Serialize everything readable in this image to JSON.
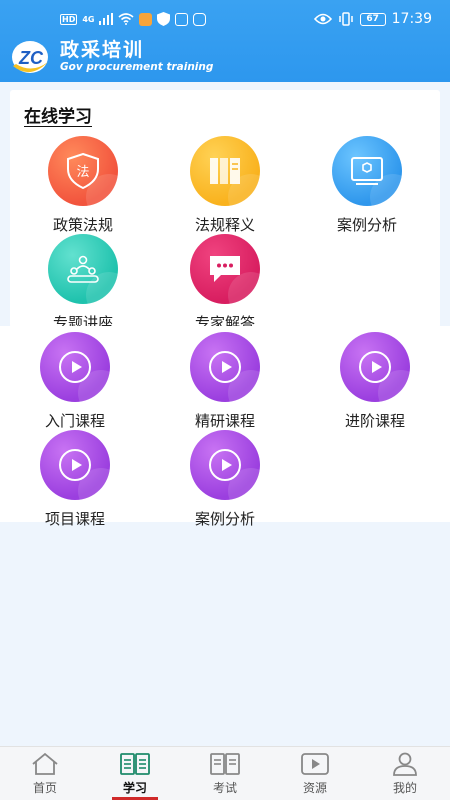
{
  "status_bar": {
    "network_type": "HD",
    "signal_type": "4G",
    "battery": "67",
    "time": "17:39"
  },
  "header": {
    "title": "政采培训",
    "subtitle": "Gov procurement training"
  },
  "online_learning": {
    "section_title": "在线学习",
    "items": [
      {
        "label": "政策法规",
        "icon": "law-shield-icon",
        "color": "#f2543d"
      },
      {
        "label": "法规释义",
        "icon": "book-shelf-icon",
        "color": "#f9b21e"
      },
      {
        "label": "案例分析",
        "icon": "case-board-icon",
        "color": "#2f97ec"
      },
      {
        "label": "专题讲座",
        "icon": "lecture-icon",
        "color": "#1fc2ad"
      },
      {
        "label": "专家解答",
        "icon": "chat-bubble-icon",
        "color": "#d81e60"
      }
    ]
  },
  "courses": {
    "items": [
      {
        "label": "入门课程",
        "icon": "play-icon"
      },
      {
        "label": "精研课程",
        "icon": "play-icon"
      },
      {
        "label": "进阶课程",
        "icon": "play-icon"
      },
      {
        "label": "项目课程",
        "icon": "play-icon"
      },
      {
        "label": "案例分析",
        "icon": "play-icon"
      }
    ],
    "color": "#9b3fdf"
  },
  "bottom_nav": {
    "items": [
      {
        "label": "首页",
        "icon": "home-icon"
      },
      {
        "label": "学习",
        "icon": "study-book-icon",
        "active": true
      },
      {
        "label": "考试",
        "icon": "exam-book-icon"
      },
      {
        "label": "资源",
        "icon": "video-resource-icon"
      },
      {
        "label": "我的",
        "icon": "user-icon"
      }
    ],
    "active_color": "#d02a2a"
  }
}
